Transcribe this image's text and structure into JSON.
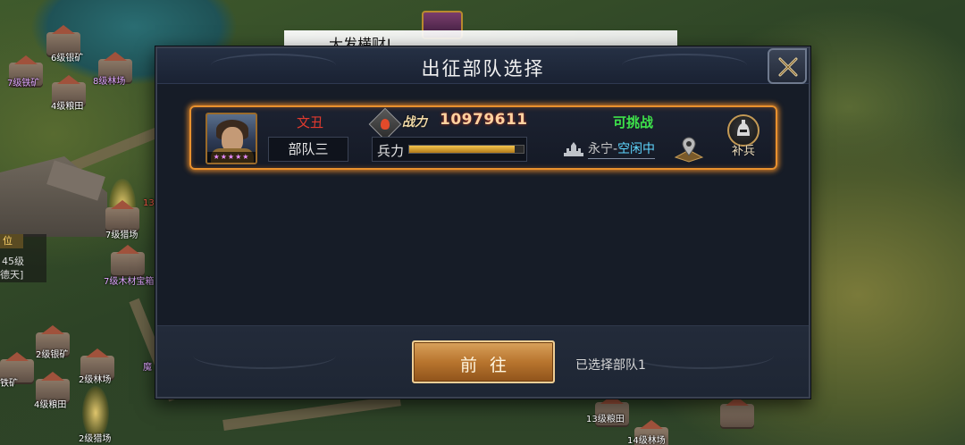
{
  "toast": {
    "text": "大发横财!"
  },
  "map_labels": [
    {
      "text": "6级银矿",
      "style": ""
    },
    {
      "text": "7级铁矿",
      "style": "purple"
    },
    {
      "text": "8级林场",
      "style": "purple"
    },
    {
      "text": "4级粮田",
      "style": ""
    },
    {
      "text": "7级猎场",
      "style": ""
    },
    {
      "text": "7级木材宝箱",
      "style": "purple"
    },
    {
      "text": "2级银矿",
      "style": ""
    },
    {
      "text": "2级林场",
      "style": ""
    },
    {
      "text": "4级粮田",
      "style": ""
    },
    {
      "text": "2级猎场",
      "style": ""
    },
    {
      "text": "13级粮田",
      "style": ""
    },
    {
      "text": "14级林场",
      "style": ""
    },
    {
      "text": "位",
      "style": ""
    },
    {
      "text": "45级",
      "style": ""
    },
    {
      "text": "德天]",
      "style": ""
    },
    {
      "text": "魔",
      "style": "purple"
    },
    {
      "text": "13",
      "style": "red"
    },
    {
      "text": "铁矿",
      "style": ""
    }
  ],
  "dialog": {
    "title": "出征部队选择",
    "close_icon": "close-x-icon",
    "troop": {
      "hero_name": "文丑",
      "hero_stars": "★★★★★",
      "troop_name": "部队三",
      "power_label": "战力",
      "power_value": "10979611",
      "strength_label": "兵力",
      "strength_fraction": 0.92,
      "status": "可挑战",
      "location_city": "永宁",
      "location_sep": "-",
      "location_state": "空闲中",
      "reinforce_label": "补兵"
    },
    "footer": {
      "go_label": "前往",
      "selected_text": "已选择部队1"
    }
  },
  "colors": {
    "highlight_border": "#e9912e",
    "hero_name": "#e13a2e",
    "status_green": "#3ee24a",
    "idle_cyan": "#5fd6ff"
  }
}
